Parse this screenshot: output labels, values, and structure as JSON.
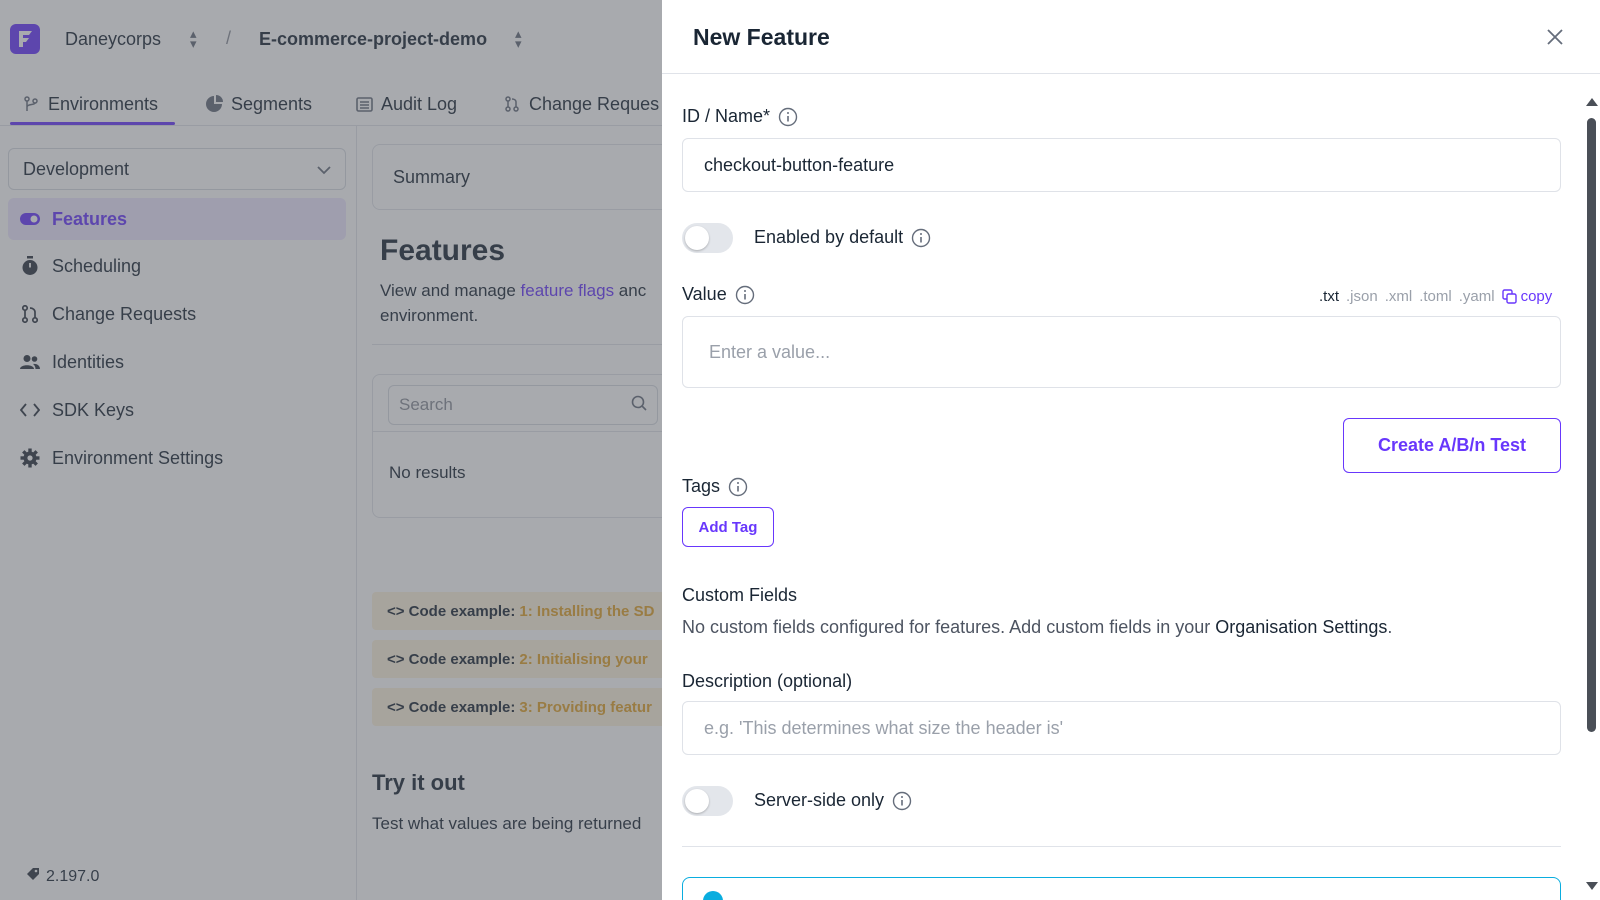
{
  "topbar": {
    "organisation": "Daneycorps",
    "project": "E-commerce-project-demo",
    "separator": "/"
  },
  "nav_tabs": [
    {
      "label": "Environments",
      "icon": "git-branch-icon"
    },
    {
      "label": "Segments",
      "icon": "pie-chart-icon"
    },
    {
      "label": "Audit Log",
      "icon": "list-icon"
    },
    {
      "label": "Change Reques",
      "icon": "pull-request-icon"
    }
  ],
  "sidebar": {
    "environment": "Development",
    "items": [
      {
        "label": "Features",
        "icon": "toggle-icon"
      },
      {
        "label": "Scheduling",
        "icon": "stopwatch-icon"
      },
      {
        "label": "Change Requests",
        "icon": "pull-request-icon"
      },
      {
        "label": "Identities",
        "icon": "people-icon"
      },
      {
        "label": "SDK Keys",
        "icon": "code-icon"
      },
      {
        "label": "Environment Settings",
        "icon": "gear-icon"
      }
    ],
    "version": "2.197.0"
  },
  "main": {
    "summary_label": "Summary",
    "title": "Features",
    "desc_prefix": "View and manage ",
    "desc_link": "feature flags",
    "desc_suffix": " anc",
    "desc_line2": "environment.",
    "search_placeholder": "Search",
    "no_results": "No results",
    "code_examples": [
      {
        "prefix": "<> Code example:",
        "step": "1: Installing the SD"
      },
      {
        "prefix": "<> Code example:",
        "step": "2: Initialising your"
      },
      {
        "prefix": "<> Code example:",
        "step": "3: Providing featur"
      }
    ],
    "try_title": "Try it out",
    "try_desc": "Test what values are being returned"
  },
  "modal": {
    "title": "New Feature",
    "id_label": "ID / Name*",
    "id_value": "checkout-button-feature",
    "enabled_label": "Enabled by default",
    "enabled": false,
    "value_label": "Value",
    "value_placeholder": "Enter a value...",
    "formats": [
      ".txt",
      ".json",
      ".xml",
      ".toml",
      ".yaml"
    ],
    "active_format": ".txt",
    "copy_label": "copy",
    "ab_test_button": "Create A/B/n Test",
    "tags_label": "Tags",
    "add_tag_button": "Add Tag",
    "custom_fields_label": "Custom Fields",
    "custom_fields_text": "No custom fields configured for features. Add custom fields in your ",
    "custom_fields_link": "Organisation Settings",
    "custom_fields_end": ".",
    "description_label": "Description (optional)",
    "description_placeholder": "e.g. 'This determines what size the header is'",
    "server_side_label": "Server-side only",
    "server_side": false
  },
  "colors": {
    "accent": "#6837fc",
    "accent_light": "#ece6ff",
    "code_step": "#e0a22b",
    "info_border": "#0aaddf"
  }
}
